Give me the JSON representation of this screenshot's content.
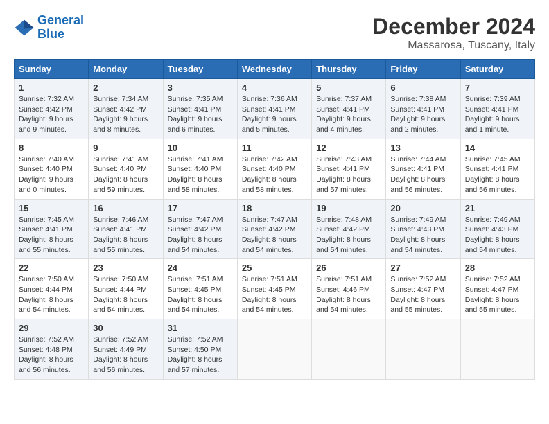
{
  "header": {
    "logo_line1": "General",
    "logo_line2": "Blue",
    "month_title": "December 2024",
    "location": "Massarosa, Tuscany, Italy"
  },
  "columns": [
    "Sunday",
    "Monday",
    "Tuesday",
    "Wednesday",
    "Thursday",
    "Friday",
    "Saturday"
  ],
  "weeks": [
    [
      {
        "day": "1",
        "sunrise": "7:32 AM",
        "sunset": "4:42 PM",
        "daylight": "9 hours and 9 minutes."
      },
      {
        "day": "2",
        "sunrise": "7:34 AM",
        "sunset": "4:42 PM",
        "daylight": "9 hours and 8 minutes."
      },
      {
        "day": "3",
        "sunrise": "7:35 AM",
        "sunset": "4:41 PM",
        "daylight": "9 hours and 6 minutes."
      },
      {
        "day": "4",
        "sunrise": "7:36 AM",
        "sunset": "4:41 PM",
        "daylight": "9 hours and 5 minutes."
      },
      {
        "day": "5",
        "sunrise": "7:37 AM",
        "sunset": "4:41 PM",
        "daylight": "9 hours and 4 minutes."
      },
      {
        "day": "6",
        "sunrise": "7:38 AM",
        "sunset": "4:41 PM",
        "daylight": "9 hours and 2 minutes."
      },
      {
        "day": "7",
        "sunrise": "7:39 AM",
        "sunset": "4:41 PM",
        "daylight": "9 hours and 1 minute."
      }
    ],
    [
      {
        "day": "8",
        "sunrise": "7:40 AM",
        "sunset": "4:40 PM",
        "daylight": "9 hours and 0 minutes."
      },
      {
        "day": "9",
        "sunrise": "7:41 AM",
        "sunset": "4:40 PM",
        "daylight": "8 hours and 59 minutes."
      },
      {
        "day": "10",
        "sunrise": "7:41 AM",
        "sunset": "4:40 PM",
        "daylight": "8 hours and 58 minutes."
      },
      {
        "day": "11",
        "sunrise": "7:42 AM",
        "sunset": "4:40 PM",
        "daylight": "8 hours and 58 minutes."
      },
      {
        "day": "12",
        "sunrise": "7:43 AM",
        "sunset": "4:41 PM",
        "daylight": "8 hours and 57 minutes."
      },
      {
        "day": "13",
        "sunrise": "7:44 AM",
        "sunset": "4:41 PM",
        "daylight": "8 hours and 56 minutes."
      },
      {
        "day": "14",
        "sunrise": "7:45 AM",
        "sunset": "4:41 PM",
        "daylight": "8 hours and 56 minutes."
      }
    ],
    [
      {
        "day": "15",
        "sunrise": "7:45 AM",
        "sunset": "4:41 PM",
        "daylight": "8 hours and 55 minutes."
      },
      {
        "day": "16",
        "sunrise": "7:46 AM",
        "sunset": "4:41 PM",
        "daylight": "8 hours and 55 minutes."
      },
      {
        "day": "17",
        "sunrise": "7:47 AM",
        "sunset": "4:42 PM",
        "daylight": "8 hours and 54 minutes."
      },
      {
        "day": "18",
        "sunrise": "7:47 AM",
        "sunset": "4:42 PM",
        "daylight": "8 hours and 54 minutes."
      },
      {
        "day": "19",
        "sunrise": "7:48 AM",
        "sunset": "4:42 PM",
        "daylight": "8 hours and 54 minutes."
      },
      {
        "day": "20",
        "sunrise": "7:49 AM",
        "sunset": "4:43 PM",
        "daylight": "8 hours and 54 minutes."
      },
      {
        "day": "21",
        "sunrise": "7:49 AM",
        "sunset": "4:43 PM",
        "daylight": "8 hours and 54 minutes."
      }
    ],
    [
      {
        "day": "22",
        "sunrise": "7:50 AM",
        "sunset": "4:44 PM",
        "daylight": "8 hours and 54 minutes."
      },
      {
        "day": "23",
        "sunrise": "7:50 AM",
        "sunset": "4:44 PM",
        "daylight": "8 hours and 54 minutes."
      },
      {
        "day": "24",
        "sunrise": "7:51 AM",
        "sunset": "4:45 PM",
        "daylight": "8 hours and 54 minutes."
      },
      {
        "day": "25",
        "sunrise": "7:51 AM",
        "sunset": "4:45 PM",
        "daylight": "8 hours and 54 minutes."
      },
      {
        "day": "26",
        "sunrise": "7:51 AM",
        "sunset": "4:46 PM",
        "daylight": "8 hours and 54 minutes."
      },
      {
        "day": "27",
        "sunrise": "7:52 AM",
        "sunset": "4:47 PM",
        "daylight": "8 hours and 55 minutes."
      },
      {
        "day": "28",
        "sunrise": "7:52 AM",
        "sunset": "4:47 PM",
        "daylight": "8 hours and 55 minutes."
      }
    ],
    [
      {
        "day": "29",
        "sunrise": "7:52 AM",
        "sunset": "4:48 PM",
        "daylight": "8 hours and 56 minutes."
      },
      {
        "day": "30",
        "sunrise": "7:52 AM",
        "sunset": "4:49 PM",
        "daylight": "8 hours and 56 minutes."
      },
      {
        "day": "31",
        "sunrise": "7:52 AM",
        "sunset": "4:50 PM",
        "daylight": "8 hours and 57 minutes."
      },
      null,
      null,
      null,
      null
    ]
  ]
}
